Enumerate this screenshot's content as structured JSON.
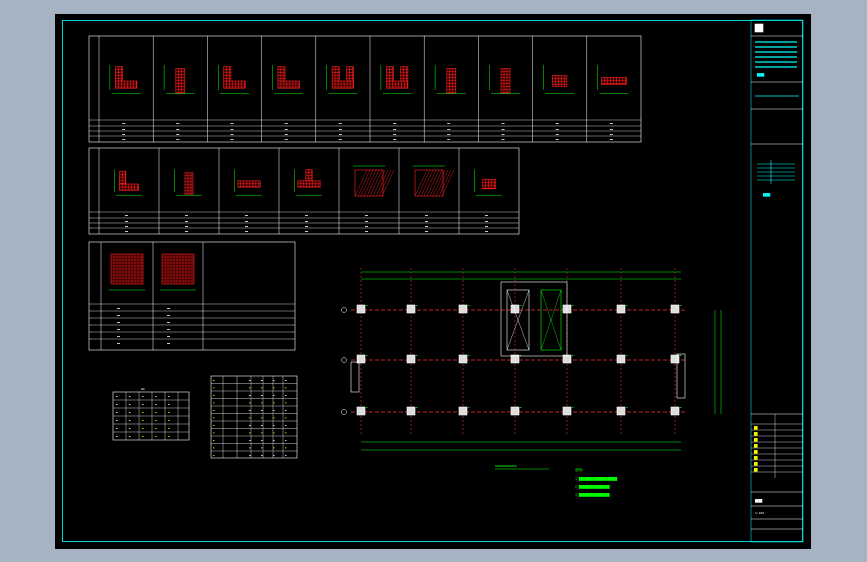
{
  "colors": {
    "background": "#000000",
    "border": "#00d8d8",
    "table_line": "#ffffff",
    "rebar": "#ff2020",
    "dimension": "#00ff00",
    "axis": "#ff3030",
    "text": "#ffffff",
    "label_yellow": "#ffff00",
    "window": "#a6b3c2"
  },
  "title_block": {
    "header_glyph": "⊞",
    "company_line1": "██████████",
    "company_line2": "████████",
    "drawing_name": "████",
    "sheet_no": "██",
    "scale": "1:100"
  },
  "column_tables": {
    "row1_count": 10,
    "row2_count": 7,
    "row3_count": 2
  },
  "plan": {
    "title": "█████████████",
    "notes_heading": "说明:",
    "notes": [
      "1.████████████████████",
      "2.████████████████",
      "3.████████████████"
    ]
  },
  "legend": {
    "header": "███",
    "table2_header": "████"
  }
}
